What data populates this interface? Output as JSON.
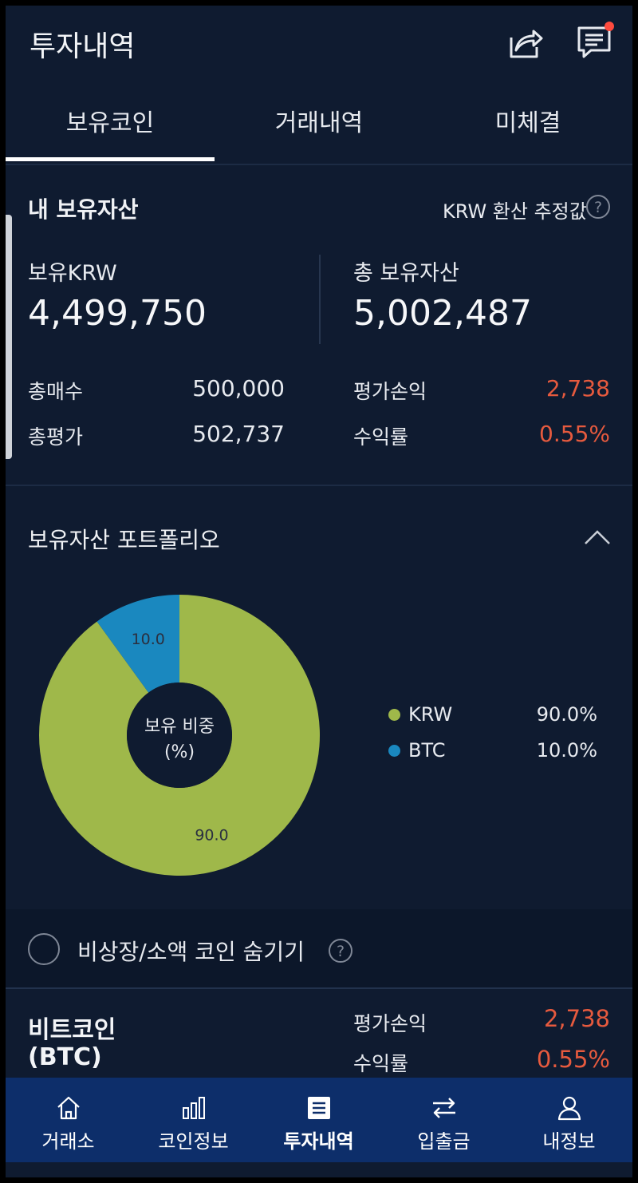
{
  "header": {
    "title": "투자내역",
    "share_icon": "share-icon",
    "chat_icon": "chat-icon"
  },
  "tabs": [
    {
      "label": "보유코인",
      "active": true
    },
    {
      "label": "거래내역",
      "active": false
    },
    {
      "label": "미체결",
      "active": false
    }
  ],
  "assets": {
    "title": "내 보유자산",
    "estimate_label": "KRW 환산 추정값",
    "krw_label": "보유KRW",
    "krw_value": "4,499,750",
    "total_label": "총 보유자산",
    "total_value": "5,002,487",
    "buy_total_label": "총매수",
    "buy_total_value": "500,000",
    "eval_total_label": "총평가",
    "eval_total_value": "502,737",
    "pnl_label": "평가손익",
    "pnl_value": "2,738",
    "return_label": "수익률",
    "return_value": "0.55%"
  },
  "portfolio": {
    "title": "보유자산 포트폴리오",
    "donut_center_line1": "보유 비중",
    "donut_center_line2": "(%)",
    "colors": {
      "KRW": "#9fb84a",
      "BTC": "#1a88bf"
    }
  },
  "chart_data": {
    "type": "pie",
    "title": "",
    "slices": [
      {
        "name": "KRW",
        "value": 90.0,
        "label": "90.0",
        "legend_pct": "90.0%"
      },
      {
        "name": "BTC",
        "value": 10.0,
        "label": "10.0",
        "legend_pct": "10.0%"
      }
    ]
  },
  "filter": {
    "hide_label": "비상장/소액 코인 숨기기"
  },
  "coin": {
    "name_line1": "비트코인",
    "name_line2": "(BTC)",
    "pnl_label": "평가손익",
    "pnl_value": "2,738",
    "return_label": "수익률",
    "return_value": "0.55%"
  },
  "bottom_nav": [
    {
      "label": "거래소",
      "icon": "home-icon",
      "active": false
    },
    {
      "label": "코인정보",
      "icon": "bar-chart-icon",
      "active": false
    },
    {
      "label": "투자내역",
      "icon": "document-icon",
      "active": true
    },
    {
      "label": "입출금",
      "icon": "transfer-arrows-icon",
      "active": false
    },
    {
      "label": "내정보",
      "icon": "user-icon",
      "active": false
    }
  ]
}
